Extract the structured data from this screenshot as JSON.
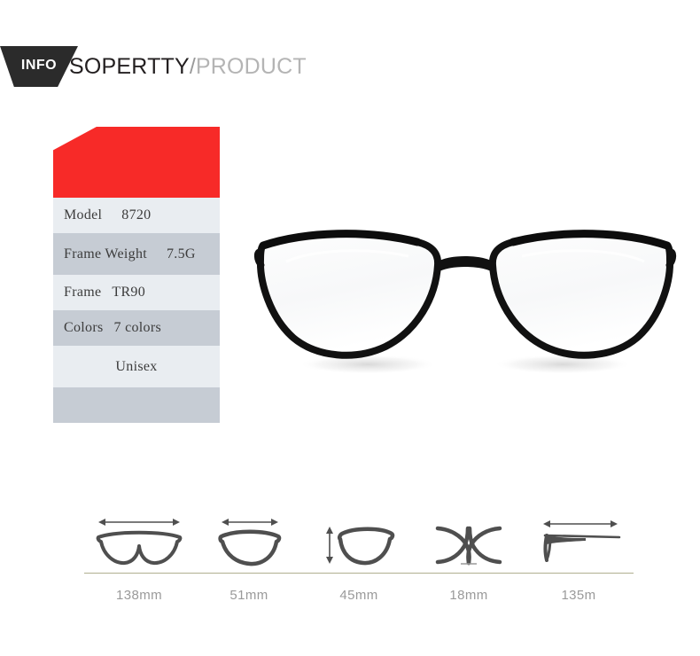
{
  "header": {
    "badge_label": "INFO",
    "brand_main": "SOPERTTY",
    "brand_separator": "/",
    "brand_sub": "PRODUCT"
  },
  "spec_table": {
    "accent_color": "#f72a28",
    "row_light_color": "#e9edf1",
    "row_dark_color": "#c6ccd4",
    "rows": [
      {
        "key": "Model",
        "value": "8720"
      },
      {
        "key": "Frame Weight",
        "value": "7.5G"
      },
      {
        "key": "Frame",
        "value": "TR90"
      },
      {
        "key": "Colors",
        "value": "7 colors"
      },
      {
        "key": "",
        "value": "Unisex"
      },
      {
        "key": "",
        "value": ""
      }
    ]
  },
  "product_image": {
    "alt": "black round eyeglasses frame front view",
    "frame_color": "#111111",
    "temple_color": "#4a4a4a"
  },
  "measurements": {
    "divider_color": "#b0af90",
    "icon_color": "#4f4f4f",
    "items": [
      {
        "icon": "frame-width-icon",
        "label": "138mm"
      },
      {
        "icon": "lens-width-icon",
        "label": "51mm"
      },
      {
        "icon": "lens-height-icon",
        "label": "45mm"
      },
      {
        "icon": "bridge-width-icon",
        "label": "18mm"
      },
      {
        "icon": "temple-length-icon",
        "label": "135m"
      }
    ]
  }
}
